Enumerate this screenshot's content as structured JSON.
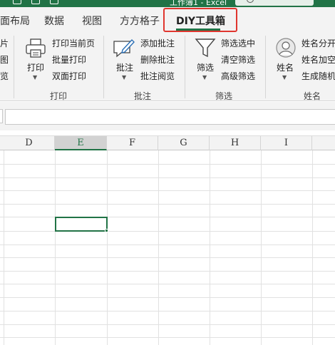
{
  "window": {
    "title": "工作簿1 - Excel",
    "accent_color": "#217346",
    "search_icon": "search-icon"
  },
  "tabs": [
    {
      "label": "面布局"
    },
    {
      "label": "数据"
    },
    {
      "label": "视图"
    },
    {
      "label": "方方格子"
    },
    {
      "label": "DIY工具箱",
      "active": true
    }
  ],
  "highlight_color": "#e0362f",
  "ribbon": {
    "left_partial": [
      "片",
      "图",
      "览"
    ],
    "print_group": {
      "big_button": {
        "label": "打印",
        "icon": "printer-icon"
      },
      "items": [
        "打印当前页",
        "批量打印",
        "双面打印"
      ],
      "group_label": "打印"
    },
    "comment_group": {
      "big_button": {
        "label": "批注",
        "icon": "pencil-note-icon"
      },
      "items": [
        "添加批注",
        "删除批注",
        "批注阅览"
      ],
      "group_label": "批注"
    },
    "filter_group": {
      "big_button": {
        "label": "筛选",
        "icon": "funnel-icon"
      },
      "items": [
        "筛选选中",
        "清空筛选",
        "高级筛选"
      ],
      "group_label": "筛选"
    },
    "name_group": {
      "big_button": {
        "label": "姓名",
        "icon": "person-icon"
      },
      "items": [
        "姓名分开",
        "姓名加空",
        "生成随机"
      ],
      "group_label": "姓名"
    }
  },
  "formula_bar": {
    "value": ""
  },
  "sheet": {
    "columns": [
      {
        "label": "D"
      },
      {
        "label": "E",
        "selected": true
      },
      {
        "label": "F"
      },
      {
        "label": "G"
      },
      {
        "label": "H"
      },
      {
        "label": "I"
      }
    ],
    "active_cell": "E6"
  }
}
